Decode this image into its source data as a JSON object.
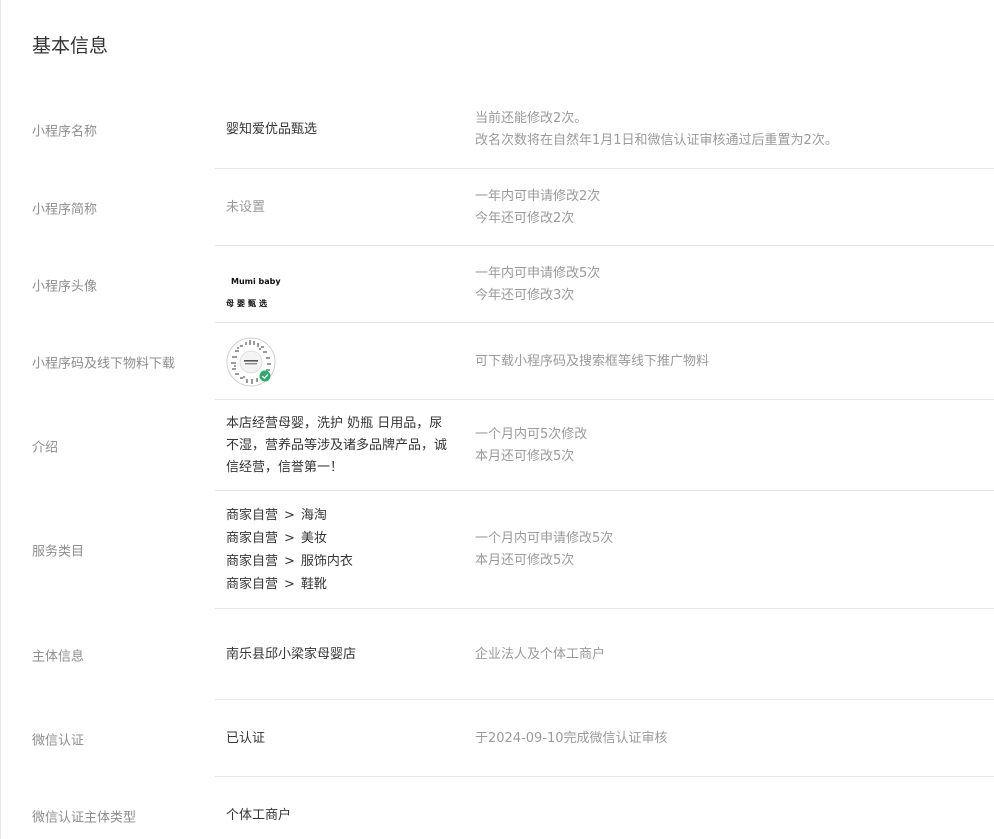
{
  "section_title": "基本信息",
  "rows": {
    "name": {
      "label": "小程序名称",
      "value": "婴知爱优品甄选",
      "desc1": "当前还能修改2次。",
      "desc2": "改名次数将在自然年1月1日和微信认证审核通过后重置为2次。"
    },
    "short_name": {
      "label": "小程序简称",
      "value": "未设置",
      "desc1": "一年内可申请修改2次",
      "desc2": "今年还可修改2次"
    },
    "avatar": {
      "label": "小程序头像",
      "logo_line1": "Mumi baby",
      "logo_line2": "母婴甄选",
      "desc1": "一年内可申请修改5次",
      "desc2": "今年还可修改3次"
    },
    "qrcode": {
      "label": "小程序码及线下物料下载",
      "desc1": "可下载小程序码及搜索框等线下推广物料"
    },
    "intro": {
      "label": "介绍",
      "value": "本店经营母婴，洗护 奶瓶 日用品，尿不湿，营养品等涉及诸多品牌产品，诚信经营，信誉第一！",
      "desc1": "一个月内可5次修改",
      "desc2": "本月还可修改5次"
    },
    "categories": {
      "label": "服务类目",
      "items": [
        {
          "parent": "商家自营",
          "child": "海淘"
        },
        {
          "parent": "商家自营",
          "child": "美妆"
        },
        {
          "parent": "商家自营",
          "child": "服饰内衣"
        },
        {
          "parent": "商家自营",
          "child": "鞋靴"
        }
      ],
      "separator": ">",
      "desc1": "一个月内可申请修改5次",
      "desc2": "本月还可修改5次"
    },
    "entity": {
      "label": "主体信息",
      "value": "南乐县邱小梁家母婴店",
      "desc1": "企业法人及个体工商户"
    },
    "wechat_cert": {
      "label": "微信认证",
      "value": "已认证",
      "desc1": "于2024-09-10完成微信认证审核"
    },
    "cert_type": {
      "label": "微信认证主体类型",
      "value": "个体工商户"
    }
  },
  "colors": {
    "divider": "#e7e7eb",
    "label": "#8d8d8d",
    "value": "#353535",
    "desc": "#9a9a9a",
    "qr_badge": "#2aae67"
  }
}
